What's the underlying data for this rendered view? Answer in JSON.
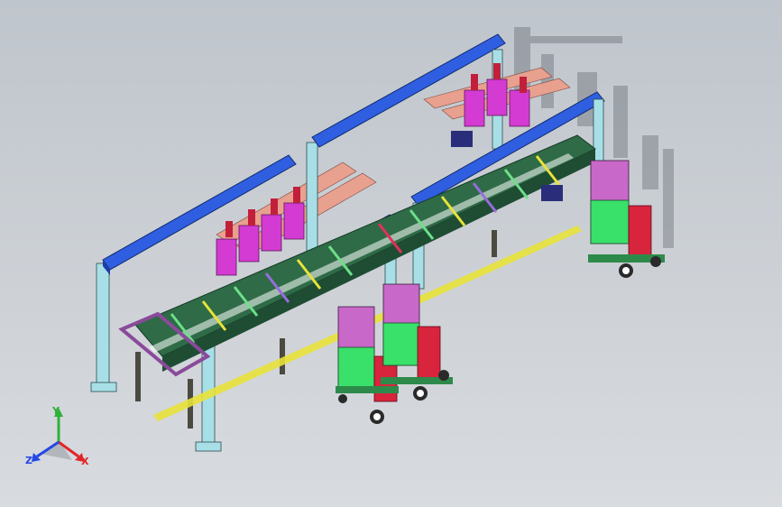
{
  "viewport": {
    "background_top": "#bfc5cc",
    "background_bottom": "#d8dbdf"
  },
  "model": {
    "description_colors": {
      "beam": "#2f5fe0",
      "post": "#a8dfe6",
      "rail": "#e8a08f",
      "magenta": "#d43bd2",
      "conveyor_frame": "#3a8a5a",
      "welder_green": "#39e06a",
      "welder_red": "#d8243c",
      "yellow": "#e8e23a"
    }
  },
  "triad": {
    "x_label": "X",
    "y_label": "Y",
    "z_label": "Z",
    "x_color": "#e0262a",
    "y_color": "#2fb13a",
    "z_color": "#2447e6"
  }
}
